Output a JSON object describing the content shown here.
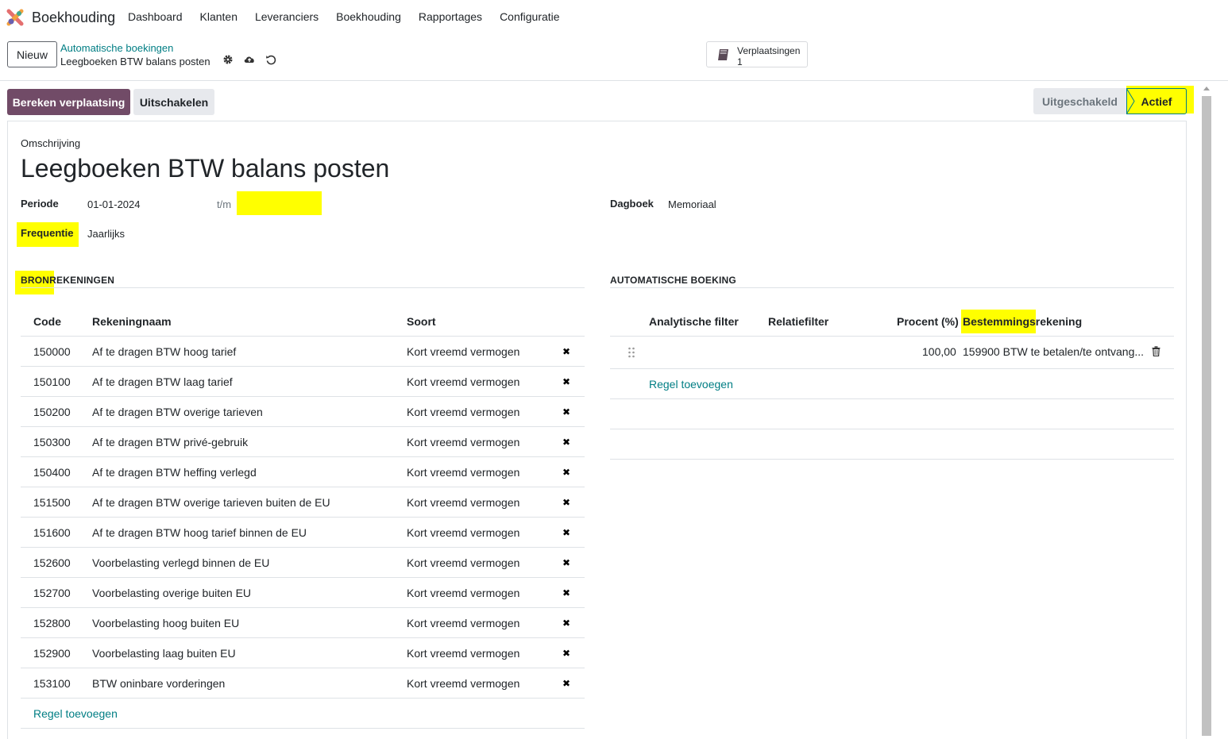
{
  "navbar": {
    "app_name": "Boekhouding",
    "items": [
      "Dashboard",
      "Klanten",
      "Leveranciers",
      "Boekhouding",
      "Rapportages",
      "Configuratie"
    ]
  },
  "control": {
    "new_label": "Nieuw",
    "breadcrumb_parent": "Automatische boekingen",
    "breadcrumb_current": "Leegboeken BTW balans posten",
    "icons": [
      "gear-icon",
      "cloud-upload-icon",
      "undo-icon"
    ],
    "smart_button": {
      "label": "Verplaatsingen",
      "value": "1",
      "icon": "book-icon"
    }
  },
  "statusbar": {
    "primary_button": "Bereken verplaatsing",
    "secondary_button": "Uitschakelen",
    "states": [
      "Uitgeschakeld",
      "Actief"
    ],
    "active_state": "Actief"
  },
  "form": {
    "description_label": "Omschrijving",
    "title": "Leegboeken BTW balans posten",
    "period_label": "Periode",
    "period_from": "01-01-2024",
    "period_to_label": "t/m",
    "period_to": "",
    "journal_label": "Dagboek",
    "journal_value": "Memoriaal",
    "frequency_label": "Frequentie",
    "frequency_value": "Jaarlijks"
  },
  "sources": {
    "title": "BRONREKENINGEN",
    "columns": [
      "Code",
      "Rekeningnaam",
      "Soort"
    ],
    "rows": [
      {
        "code": "150000",
        "name": "Af te dragen BTW hoog tarief",
        "type": "Kort vreemd vermogen"
      },
      {
        "code": "150100",
        "name": "Af te dragen BTW laag tarief",
        "type": "Kort vreemd vermogen"
      },
      {
        "code": "150200",
        "name": "Af te dragen BTW overige tarieven",
        "type": "Kort vreemd vermogen"
      },
      {
        "code": "150300",
        "name": "Af te dragen BTW privé-gebruik",
        "type": "Kort vreemd vermogen"
      },
      {
        "code": "150400",
        "name": "Af te dragen BTW heffing verlegd",
        "type": "Kort vreemd vermogen"
      },
      {
        "code": "151500",
        "name": "Af te dragen BTW overige tarieven buiten de EU",
        "type": "Kort vreemd vermogen"
      },
      {
        "code": "151600",
        "name": "Af te dragen BTW hoog tarief binnen de EU",
        "type": "Kort vreemd vermogen"
      },
      {
        "code": "152600",
        "name": "Voorbelasting verlegd binnen de EU",
        "type": "Kort vreemd vermogen"
      },
      {
        "code": "152700",
        "name": "Voorbelasting overige buiten EU",
        "type": "Kort vreemd vermogen"
      },
      {
        "code": "152800",
        "name": "Voorbelasting hoog buiten EU",
        "type": "Kort vreemd vermogen"
      },
      {
        "code": "152900",
        "name": "Voorbelasting laag buiten EU",
        "type": "Kort vreemd vermogen"
      },
      {
        "code": "153100",
        "name": "BTW oninbare vorderingen",
        "type": "Kort vreemd vermogen"
      }
    ],
    "add_line": "Regel toevoegen"
  },
  "booking": {
    "title": "AUTOMATISCHE BOEKING",
    "columns": [
      "Analytische filter",
      "Relatiefilter",
      "Procent (%)",
      "Bestemmingsrekening"
    ],
    "rows": [
      {
        "analytic": "",
        "partner": "",
        "percent": "100,00",
        "account": "159900 BTW te betalen/te ontvang..."
      }
    ],
    "add_line": "Regel toevoegen"
  },
  "highlight_color": "#ffff00",
  "accent_color": "#714b67",
  "link_color": "#017e84"
}
